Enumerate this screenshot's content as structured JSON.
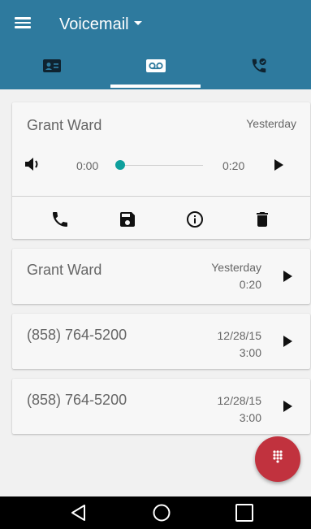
{
  "header": {
    "title": "Voicemail"
  },
  "tabs": [
    {
      "icon": "contact-card-icon"
    },
    {
      "icon": "voicemail-icon",
      "active": true
    },
    {
      "icon": "call-history-icon"
    }
  ],
  "expanded_item": {
    "name": "Grant Ward",
    "date": "Yesterday",
    "current_time": "0:00",
    "total_time": "0:20",
    "progress": 0,
    "actions": [
      "phone-icon",
      "save-icon",
      "info-icon",
      "delete-icon"
    ]
  },
  "voicemails": [
    {
      "name": "Grant Ward",
      "date": "Yesterday",
      "duration": "0:20"
    },
    {
      "name": "(858) 764-5200",
      "date": "12/28/15",
      "duration": "3:00"
    },
    {
      "name": "(858) 764-5200",
      "date": "12/28/15",
      "duration": "3:00"
    }
  ],
  "colors": {
    "appbar": "#2e7a9e",
    "accent": "#0fa09d",
    "fab": "#c1323e"
  }
}
